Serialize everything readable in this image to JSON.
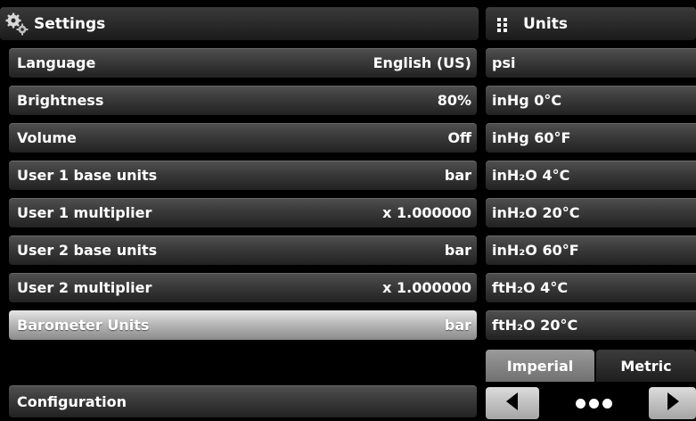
{
  "settings": {
    "title": "Settings",
    "rows": [
      {
        "label": "Language",
        "value": "English (US)"
      },
      {
        "label": "Brightness",
        "value": "80%"
      },
      {
        "label": "Volume",
        "value": "Off"
      },
      {
        "label": "User 1 base units",
        "value": "bar"
      },
      {
        "label": "User 1 multiplier",
        "value": "x 1.000000"
      },
      {
        "label": "User 2 base units",
        "value": "bar"
      },
      {
        "label": "User 2 multiplier",
        "value": "x 1.000000"
      },
      {
        "label": "Barometer Units",
        "value": "bar"
      }
    ],
    "selected_row": "Barometer Units",
    "configuration_label": "Configuration"
  },
  "units": {
    "title": "Units",
    "items": [
      "psi",
      "inHg 0°C",
      "inHg 60°F",
      "inH₂O 4°C",
      "inH₂O 20°C",
      "inH₂O 60°F",
      "ftH₂O 4°C",
      "ftH₂O 20°C"
    ],
    "tabs": [
      {
        "label": "Imperial",
        "active": true
      },
      {
        "label": "Metric",
        "active": false
      }
    ]
  },
  "icons": {
    "settings": "gear-icon",
    "units": "grid-icon",
    "prev": "arrow-left-icon",
    "next": "arrow-right-icon",
    "pager": "page-dots-icon"
  }
}
